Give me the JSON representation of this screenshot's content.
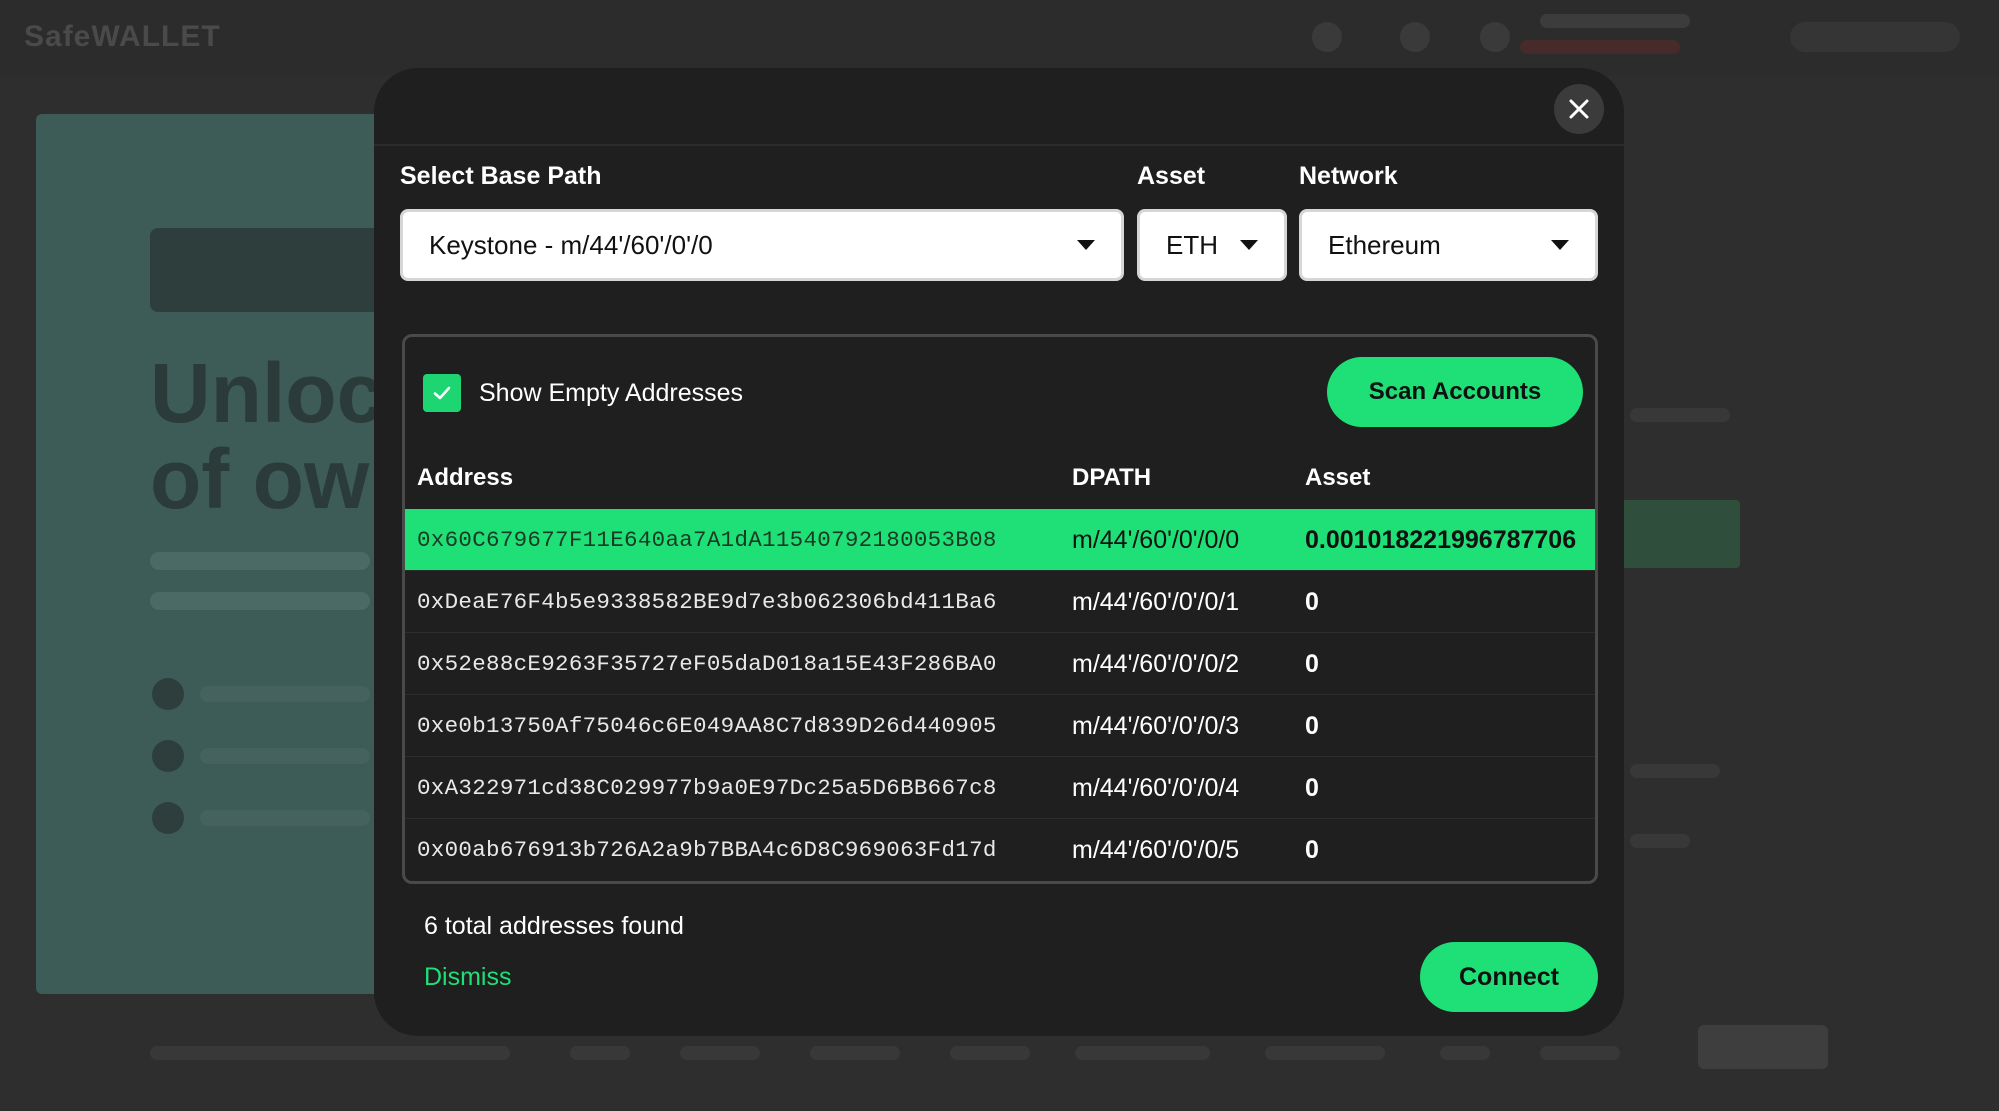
{
  "background": {
    "logo_text": "SafeWALLET"
  },
  "modal": {
    "close_icon": "close-icon",
    "base_path": {
      "label": "Select Base Path",
      "value": "Keystone - m/44'/60'/0'/0"
    },
    "asset": {
      "label": "Asset",
      "value": "ETH"
    },
    "network": {
      "label": "Network",
      "value": "Ethereum"
    },
    "show_empty": {
      "label": "Show Empty Addresses",
      "checked": true
    },
    "scan_label": "Scan Accounts",
    "table": {
      "headers": [
        "Address",
        "DPATH",
        "Asset"
      ],
      "rows": [
        {
          "address": "0x60C679677F11E640aa7A1dA11540792180053B08",
          "dpath": "m/44'/60'/0'/0/0",
          "asset": "0.001018221996787706",
          "selected": true
        },
        {
          "address": "0xDeaE76F4b5e9338582BE9d7e3b062306bd411Ba6",
          "dpath": "m/44'/60'/0'/0/1",
          "asset": "0",
          "selected": false
        },
        {
          "address": "0x52e88cE9263F35727eF05daD018a15E43F286BA0",
          "dpath": "m/44'/60'/0'/0/2",
          "asset": "0",
          "selected": false
        },
        {
          "address": "0xe0b13750Af75046c6E049AA8C7d839D26d440905",
          "dpath": "m/44'/60'/0'/0/3",
          "asset": "0",
          "selected": false
        },
        {
          "address": "0xA322971cd38C029977b9a0E97Dc25a5D6BB667c8",
          "dpath": "m/44'/60'/0'/0/4",
          "asset": "0",
          "selected": false
        },
        {
          "address": "0x00ab676913b726A2a9b7BBA4c6D8C969063Fd17d",
          "dpath": "m/44'/60'/0'/0/5",
          "asset": "0",
          "selected": false
        }
      ]
    },
    "found_text": "6 total addresses found",
    "dismiss_label": "Dismiss",
    "connect_label": "Connect"
  },
  "colors": {
    "accent": "#1ee077",
    "modal_bg": "#1f1f1f",
    "overlay_bg": "#2e2e2e"
  }
}
